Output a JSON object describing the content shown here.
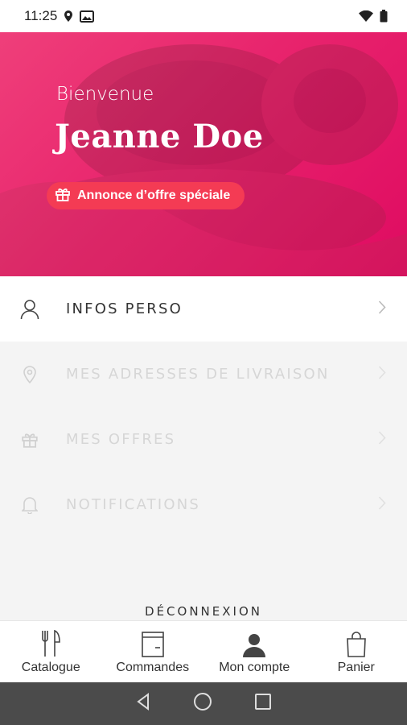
{
  "status_bar": {
    "time": "11:25"
  },
  "hero": {
    "welcome": "Bienvenue",
    "user_name": "Jeanne Doe",
    "promo_label": "Annonce d’offre spéciale",
    "accent_color": "#e8246d"
  },
  "menu": {
    "items": [
      {
        "label": "INFOS PERSO",
        "icon": "user-icon",
        "state": "active"
      },
      {
        "label": "MES ADRESSES DE LIVRAISON",
        "icon": "location-pin-icon",
        "state": "disabled"
      },
      {
        "label": "MES OFFRES",
        "icon": "gift-icon",
        "state": "disabled"
      },
      {
        "label": "NOTIFICATIONS",
        "icon": "bell-icon",
        "state": "disabled"
      }
    ],
    "logout_label": "DÉCONNEXION"
  },
  "bottom_nav": {
    "items": [
      {
        "label": "Catalogue",
        "icon": "fork-knife-icon"
      },
      {
        "label": "Commandes",
        "icon": "orders-icon"
      },
      {
        "label": "Mon compte",
        "icon": "account-icon",
        "selected": true
      },
      {
        "label": "Panier",
        "icon": "shopping-bag-icon"
      }
    ]
  }
}
